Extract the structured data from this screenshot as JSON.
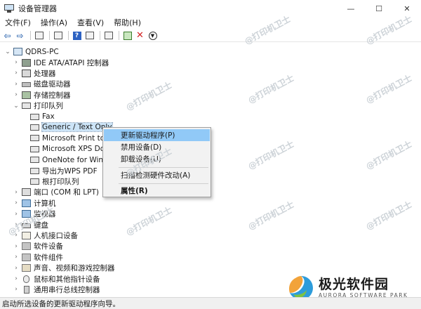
{
  "window": {
    "title": "设备管理器",
    "controls": [
      "—",
      "☐",
      "✕"
    ]
  },
  "menubar": [
    "文件(F)",
    "操作(A)",
    "查看(V)",
    "帮助(H)"
  ],
  "tree": {
    "root": "QDRS-PC",
    "categories": [
      {
        "label": "IDE ATA/ATAPI 控制器",
        "icon": "ide-controller-icon"
      },
      {
        "label": "处理器",
        "icon": "processor-icon"
      },
      {
        "label": "磁盘驱动器",
        "icon": "disk-drive-icon"
      },
      {
        "label": "存储控制器",
        "icon": "storage-controller-icon"
      },
      {
        "label": "打印队列",
        "icon": "printer-icon",
        "expanded": true
      },
      {
        "label": "端口 (COM 和 LPT)",
        "icon": "port-icon"
      },
      {
        "label": "计算机",
        "icon": "computer-icon"
      },
      {
        "label": "监视器",
        "icon": "monitor-icon"
      },
      {
        "label": "键盘",
        "icon": "keyboard-icon"
      },
      {
        "label": "人机接口设备",
        "icon": "hid-icon"
      },
      {
        "label": "软件设备",
        "icon": "software-device-icon"
      },
      {
        "label": "软件组件",
        "icon": "software-component-icon"
      },
      {
        "label": "声音、视频和游戏控制器",
        "icon": "audio-icon"
      },
      {
        "label": "鼠标和其他指针设备",
        "icon": "mouse-icon"
      },
      {
        "label": "通用串行总线控制器",
        "icon": "usb-icon"
      }
    ],
    "print_queue_children": [
      "Fax",
      "Generic / Text Only",
      "Microsoft Print to",
      "Microsoft XPS Doc",
      "OneNote for Wind",
      "导出为WPS PDF",
      "根打印队列"
    ]
  },
  "context_menu": {
    "items": [
      "更新驱动程序(P)",
      "禁用设备(D)",
      "卸载设备(U)",
      "扫描检测硬件改动(A)",
      "属性(R)"
    ]
  },
  "status_bar": "启动所选设备的更新驱动程序向导。",
  "watermark": "@打印机卫士",
  "logo": {
    "name": "极光软件园",
    "subtitle": "AURORA SOFTWARE PARK"
  }
}
